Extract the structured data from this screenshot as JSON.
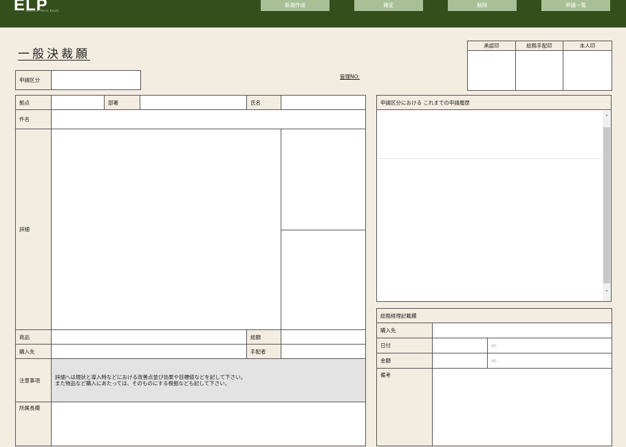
{
  "header": {
    "logo": "ELP",
    "logo_sub": "electric Parts Kochi",
    "buttons": [
      "新規作成",
      "確定",
      "削除",
      "申請一覧"
    ]
  },
  "title": "一般決裁願",
  "management_no": "管理NO:",
  "stamps": [
    "承認印",
    "総務手配印",
    "本人印"
  ],
  "form": {
    "category_label": "申請区分",
    "base_label": "拠点",
    "dept_label": "部署",
    "name_label": "氏名",
    "subject_label": "件名",
    "detail_label": "詳細",
    "product_label": "商品",
    "total_label": "総額",
    "vendor_label": "購入先",
    "arranger_label": "手配者",
    "notes_label": "注意事項",
    "notes_text_1": "詳細へは現状と導入時などにおける改善点並び効果や目標値などを記して下さい。",
    "notes_text_2": "また物品など購入にあたっては、そのものにする根拠なども記して下さい。",
    "manager_label": "所属長欄"
  },
  "history": {
    "title": "申請区分における これまでの申請履歴"
  },
  "accounting": {
    "title": "総務経理記載欄",
    "vendor_label": "購入先",
    "date_label": "日付",
    "amount_label": "金額",
    "remarks_label": "備考",
    "yen_1": "¥0",
    "yen_2": "¥0"
  }
}
